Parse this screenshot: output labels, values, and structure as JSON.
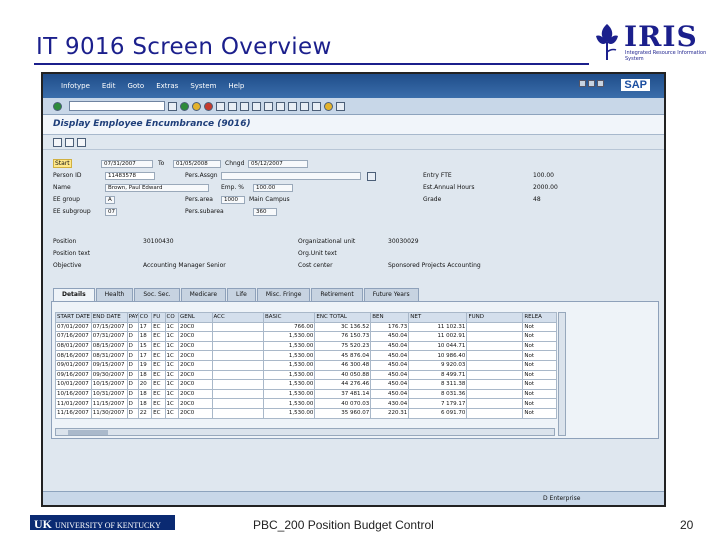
{
  "slide": {
    "title": "IT 9016 Screen Overview",
    "footer_center": "PBC_200 Position Budget Control",
    "page_number": "20",
    "footer_logo": {
      "uk": "UK",
      "name": "UNIVERSITY OF KENTUCKY"
    },
    "iris_logo": {
      "word": "IRIS",
      "subtitle": "Integrated Resource Information System"
    }
  },
  "sap": {
    "menu": [
      "Infotype",
      "Edit",
      "Goto",
      "Extras",
      "System",
      "Help"
    ],
    "logo": "SAP",
    "screen_title": "Display Employee Encumbrance (9016)",
    "header": {
      "start_label": "Start",
      "start_value": "07/31/2007",
      "to_label": "To",
      "to_value": "01/05/2008",
      "chng_label": "Chngd",
      "chng_value": "05/12/2007",
      "person_id_label": "Person ID",
      "person_id_value": "11483578",
      "name_label": "Name",
      "name_value": "Brown, Paul Edward",
      "ee_group_label": "EE group",
      "ee_group_value": "A",
      "ee_subgroup_label": "EE subgroup",
      "ee_subgroup_value": "07",
      "pers_assgn_label": "Pers.Assgn",
      "emp_pct_label": "Emp. %",
      "emp_pct_value": "100.00",
      "pers_area_label": "Pers.area",
      "pers_area_value": "1000",
      "pers_area_text": "Main Campus",
      "pers_subarea_label": "Pers.subarea",
      "pers_subarea_value": "360",
      "entry_fte_label": "Entry FTE",
      "entry_fte_value": "100.00",
      "est_hours_label": "Est.Annual Hours",
      "est_hours_value": "2000.00",
      "grade_label": "Grade",
      "grade_value": "48",
      "position_label": "Position",
      "position_value": "30100430",
      "position_text_label": "Position text",
      "objective_label": "Objective",
      "objective_value": "Accounting Manager Senior",
      "org_unit_label": "Organizational unit",
      "org_unit_value": "30030029",
      "org_unit_text_label": "Org.Unit text",
      "cost_center_label": "Cost center",
      "cost_center_value": "Sponsored Projects Accounting"
    },
    "tabs": [
      "Details",
      "Health",
      "Soc. Sec.",
      "Medicare",
      "Life",
      "Misc. Fringe",
      "Retirement",
      "Future Years"
    ],
    "table": {
      "columns": [
        "START DATE",
        "END DATE",
        "PAY",
        "CO",
        "FU",
        "CO",
        "GENL",
        "ACC",
        "BASIC",
        "ENC TOTAL",
        "BEN",
        "NET",
        "FUND",
        "RELEA"
      ],
      "rows": [
        [
          "07/01/2007",
          "07/15/2007",
          "D",
          "17",
          "EC",
          "1C",
          "20C0",
          "",
          "766.00",
          "3C 136.52",
          "176.73",
          "11 102.31",
          "",
          "Not"
        ],
        [
          "07/16/2007",
          "07/31/2007",
          "D",
          "18",
          "EC",
          "1C",
          "20C0",
          "",
          "1,530.00",
          "76 150.73",
          "450.04",
          "11 002.91",
          "",
          "Not"
        ],
        [
          "08/01/2007",
          "08/15/2007",
          "D",
          "15",
          "EC",
          "1C",
          "20C0",
          "",
          "1,530.00",
          "75 520.23",
          "450.04",
          "10 044.71",
          "",
          "Not"
        ],
        [
          "08/16/2007",
          "08/31/2007",
          "D",
          "17",
          "EC",
          "1C",
          "20C0",
          "",
          "1,530.00",
          "45 876.04",
          "450.04",
          "10 986.40",
          "",
          "Not"
        ],
        [
          "09/01/2007",
          "09/15/2007",
          "D",
          "19",
          "EC",
          "1C",
          "20C0",
          "",
          "1,530.00",
          "46 300.48",
          "450.04",
          "9 920.03",
          "",
          "Not"
        ],
        [
          "09/16/2007",
          "09/30/2007",
          "D",
          "18",
          "EC",
          "1C",
          "20C0",
          "",
          "1,530.00",
          "40 050.88",
          "450.04",
          "8 499.71",
          "",
          "Not"
        ],
        [
          "10/01/2007",
          "10/15/2007",
          "D",
          "20",
          "EC",
          "1C",
          "20C0",
          "",
          "1,530.00",
          "44 276.46",
          "450.04",
          "8 311.38",
          "",
          "Not"
        ],
        [
          "10/16/2007",
          "10/31/2007",
          "D",
          "18",
          "EC",
          "1C",
          "20C0",
          "",
          "1,530.00",
          "37 481.14",
          "450.04",
          "8 031.36",
          "",
          "Not"
        ],
        [
          "11/01/2007",
          "11/15/2007",
          "D",
          "18",
          "EC",
          "1C",
          "20C0",
          "",
          "1,530.00",
          "40 070.03",
          "430.04",
          "7 179.17",
          "",
          "Not"
        ],
        [
          "11/16/2007",
          "11/30/2007",
          "D",
          "22",
          "EC",
          "1C",
          "20C0",
          "",
          "1,530.00",
          "35 960.07",
          "220.31",
          "6 091.70",
          "",
          "Not"
        ]
      ]
    },
    "status_text": "D  Enterprise"
  },
  "colors": {
    "title": "#1b1f8c",
    "sap_blue": "#1f4d8a",
    "sap_bg": "#dfe7ef"
  }
}
